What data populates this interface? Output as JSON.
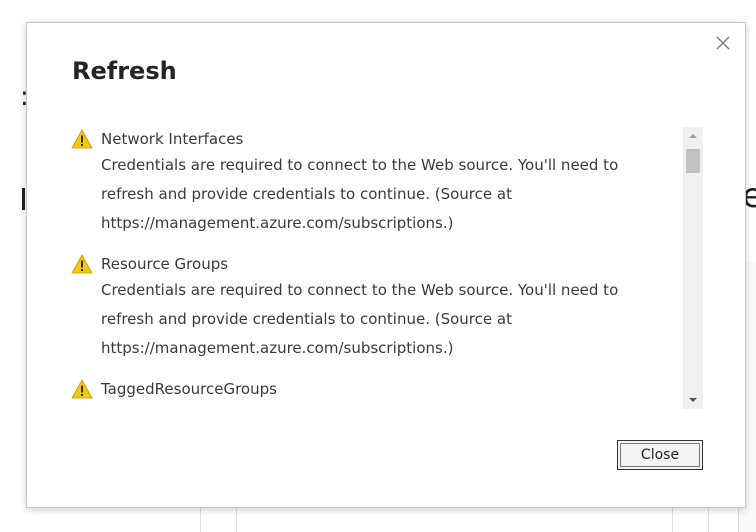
{
  "dialog": {
    "title": "Refresh",
    "close_icon": "close-icon",
    "messages": [
      {
        "icon": "warning-icon",
        "name": "Network Interfaces",
        "lines": [
          "Credentials are required to connect to the Web source. You'll need to",
          "refresh and provide credentials to continue. (Source at",
          "https://management.azure.com/subscriptions.)"
        ]
      },
      {
        "icon": "warning-icon",
        "name": "Resource Groups",
        "lines": [
          "Credentials are required to connect to the Web source. You'll need to",
          "refresh and provide credentials to continue. (Source at",
          "https://management.azure.com/subscriptions.)"
        ]
      },
      {
        "icon": "warning-icon",
        "name": "TaggedResourceGroups",
        "lines": []
      }
    ],
    "close_button_label": "Close"
  },
  "background": {
    "colon_fragment": ":",
    "letter_fragment": "e"
  },
  "colors": {
    "warning": "#f2c811",
    "title_text": "#252423",
    "body_text": "#3b3a39",
    "scroll_thumb": "#c1c1c1"
  }
}
